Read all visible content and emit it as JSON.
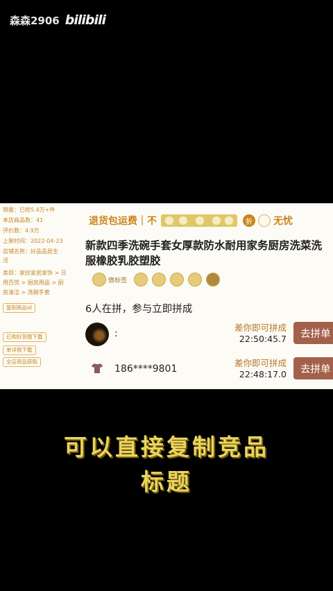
{
  "watermark": {
    "user": "森森2906",
    "logo": "bilibili"
  },
  "sidebar": {
    "lines": [
      "销量：已抢5.4万+件",
      "本店商品数：41",
      "评价数：4.9万",
      "上架时间：2022-04-23",
      "店铺名称：好品品居生",
      "活",
      "类目：家纺家居家饰  >  日",
      "用百货  >  厨房用品  >  厨",
      "房清洁  >  洗碗手套"
    ],
    "buttons": [
      "复制商品id",
      "已购好货图下载",
      "单详情下载",
      "全店商品获取"
    ]
  },
  "ribbon": {
    "left": "退货包运费｜不",
    "badge": "折",
    "right": "无忧"
  },
  "product": {
    "title_line1": "新款四季洗碗手套女厚款防水耐用家务厨房洗菜洗",
    "title_line2": "服橡胶乳胶塑胶",
    "tag_first": "傲标签"
  },
  "group": {
    "count_text": "6人在拼，参与立即拼成",
    "deals": [
      {
        "user": ":",
        "need": "差你即可拼成",
        "time": "22:50:45.7",
        "button": "去拼单"
      },
      {
        "user": "186****9801",
        "need": "差你即可拼成",
        "time": "22:48:17.0",
        "button": "去拼单"
      }
    ]
  },
  "caption": {
    "line1": "可以直接复制竞品",
    "line2": "标题"
  },
  "colors": {
    "caption": "#ecd35b",
    "join_button": "#a3604a",
    "accent": "#c9851d"
  }
}
